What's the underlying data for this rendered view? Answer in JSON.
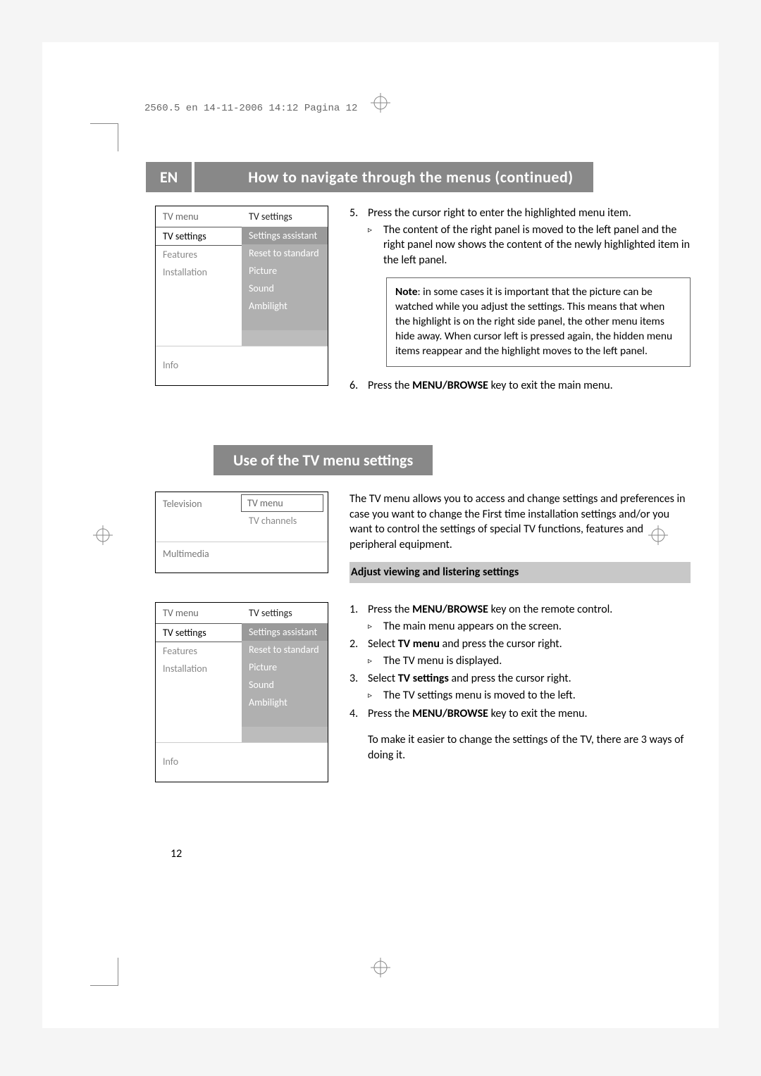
{
  "header_line": "2560.5 en  14-11-2006  14:12  Pagina 12",
  "lang_badge": "EN",
  "title1": "How to navigate through the menus  (continued)",
  "menu1": {
    "left_header": "TV menu",
    "left_items": [
      "TV settings",
      "Features",
      "Installation"
    ],
    "right_header": "TV settings",
    "right_items": [
      "Settings assistant",
      "Reset to standard",
      "Picture",
      "Sound",
      "Ambilight"
    ],
    "info": "Info"
  },
  "step5_num": "5.",
  "step5_text": "Press the cursor right to enter the highlighted menu item.",
  "step5_sub": "The content of the right panel is moved to the left panel and the right panel now shows the content of the newly highlighted item in the left panel.",
  "note_label": "Note",
  "note_text": ": in some cases it is important that the picture can be watched while you adjust the settings. This means that when the highlight is on the right side panel, the other menu items hide away. When cursor left is pressed again, the hidden menu items reappear and the highlight moves to the left panel.",
  "step6_num": "6.",
  "step6_pre": "Press the ",
  "step6_bold": "MENU/BROWSE",
  "step6_post": " key to exit the main menu.",
  "title2": "Use of the TV menu settings",
  "menu2": {
    "left_header": "Television",
    "right_header": "TV menu",
    "right_items": [
      "TV channels"
    ],
    "bottom": "Multimedia"
  },
  "intro2": "The TV menu allows you to access and change settings and preferences in case you want to change the First time installation settings and/or you want to control the settings of special TV functions, features and peripheral equipment.",
  "subhead": "Adjust viewing and listering settings",
  "s1_num": "1.",
  "s1_pre": "Press the ",
  "s1_bold": "MENU/BROWSE",
  "s1_post": " key on the remote control.",
  "s1_sub": "The main menu appears on the screen.",
  "s2_num": "2.",
  "s2_pre": "Select ",
  "s2_bold": "TV menu",
  "s2_post": " and press the cursor right.",
  "s2_sub": "The TV menu is displayed.",
  "s3_num": "3.",
  "s3_pre": "Select ",
  "s3_bold": "TV settings",
  "s3_post": " and press the cursor right.",
  "s3_sub": "The TV settings menu is moved to the left.",
  "s4_num": "4.",
  "s4_pre": "Press the ",
  "s4_bold": "MENU/BROWSE",
  "s4_post": " key to exit the menu.",
  "outro2": "To make it easier to change the settings of the TV, there are 3 ways of doing it.",
  "page_number": "12",
  "triangle": "▹"
}
